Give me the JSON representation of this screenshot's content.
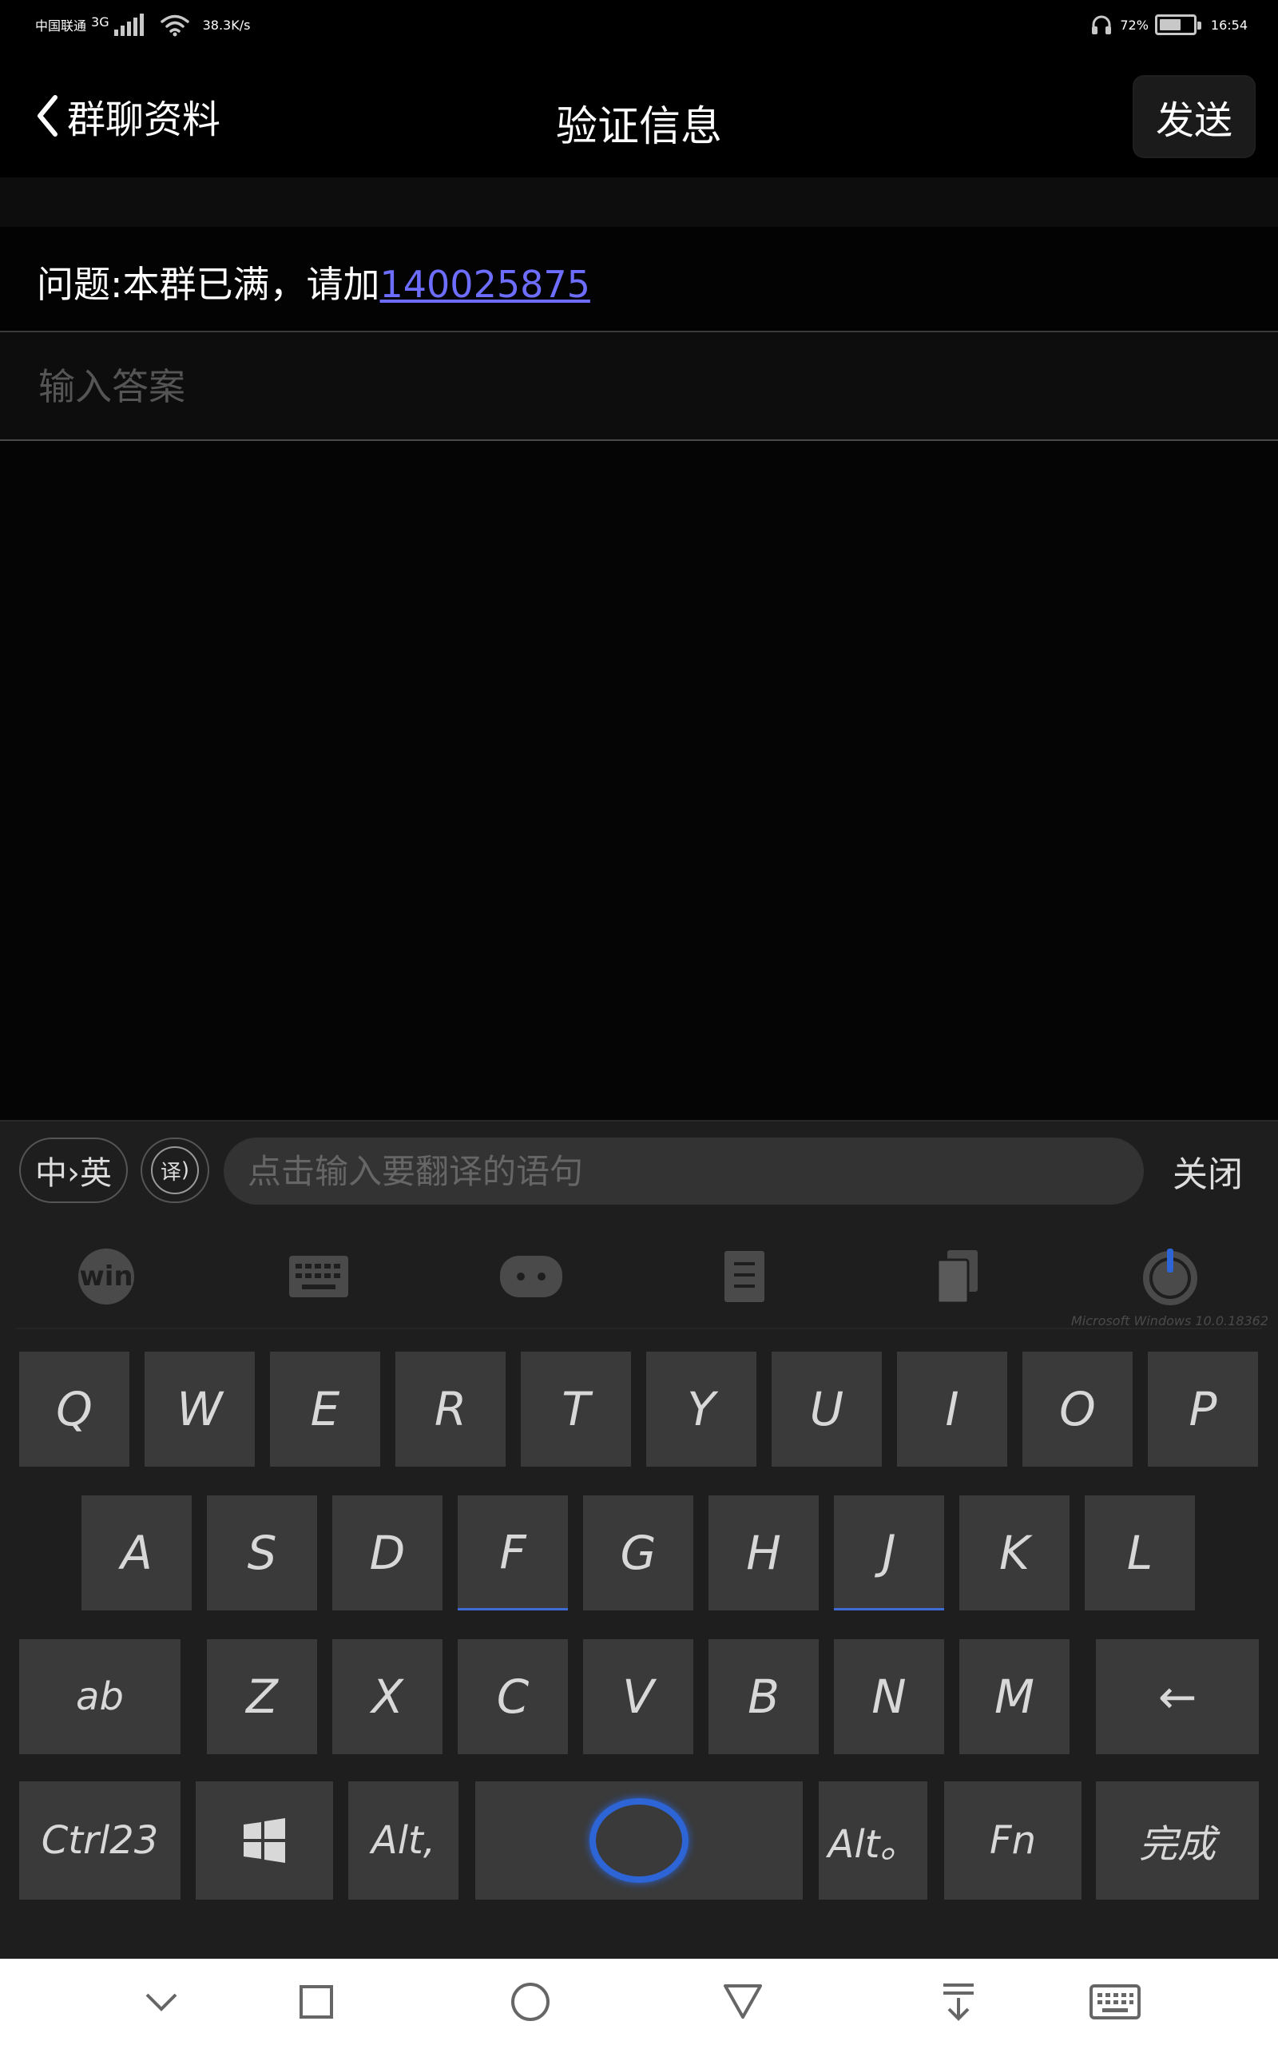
{
  "status_bar": {
    "carrier": "中国联通",
    "network_type": "3G",
    "network_speed": "38.3K/s",
    "battery": "72%",
    "battery_level": 0.72,
    "time": "16:54"
  },
  "header": {
    "back_label": "群聊资料",
    "title": "验证信息",
    "send_label": "发送"
  },
  "question": {
    "text": "问题:本群已满，请加",
    "link": "140025875"
  },
  "answer": {
    "placeholder": "输入答案",
    "value": ""
  },
  "translate_bar": {
    "lang_toggle": "中›英",
    "translate_icon_label": "译",
    "placeholder": "点击输入要翻译的语句",
    "close_label": "关闭"
  },
  "toolbar": {
    "win_label": "win",
    "caption": "Microsoft Windows 10.0.18362",
    "icons": [
      "win-icon",
      "keyboard-icon",
      "gamepad-icon",
      "document-icon",
      "copy-icon",
      "power-icon"
    ]
  },
  "keyboard": {
    "row1": [
      "Q",
      "W",
      "E",
      "R",
      "T",
      "Y",
      "U",
      "I",
      "O",
      "P"
    ],
    "row2": [
      "A",
      "S",
      "D",
      "F",
      "G",
      "H",
      "J",
      "K",
      "L"
    ],
    "row3": [
      "ab",
      "Z",
      "X",
      "C",
      "V",
      "B",
      "N",
      "M",
      "←"
    ],
    "row4": {
      "ctrl": "Ctrl23",
      "alt_left": "Alt,",
      "alt_right": "Alt。",
      "fn": "Fn",
      "done": "完成"
    },
    "accent": "#2d64d6"
  },
  "nav_bar": {
    "icons": [
      "chevron-down-icon",
      "square-icon",
      "circle-icon",
      "triangle-icon",
      "download-icon",
      "keyboard-icon"
    ]
  }
}
